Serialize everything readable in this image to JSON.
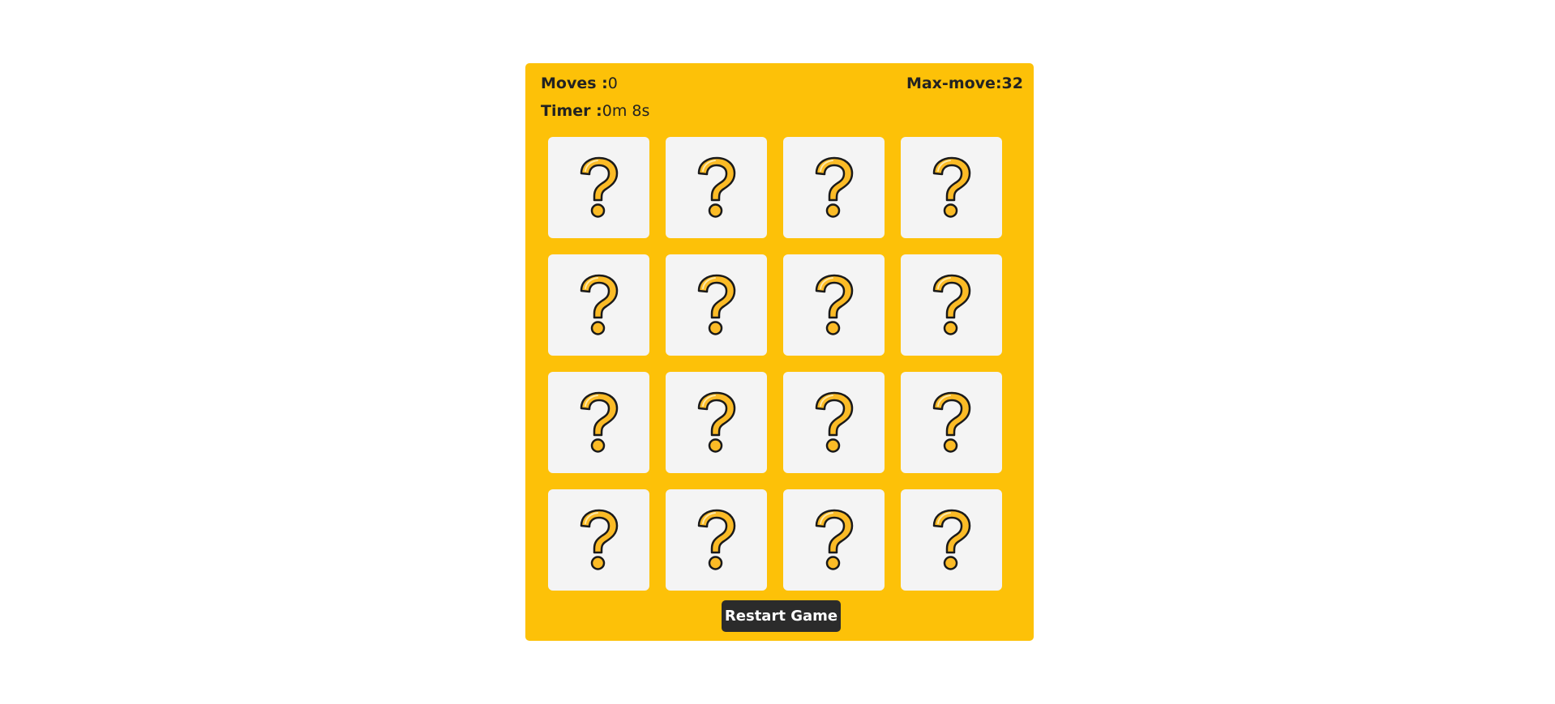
{
  "stats": {
    "moves_label": "Moves :",
    "moves_value": "0",
    "timer_label": "Timer :",
    "timer_value": "0m 8s",
    "max_moves_label": "Max-move:",
    "max_moves_value": "32"
  },
  "board": {
    "rows": 4,
    "columns": 4,
    "face_down_icon": "question-mark-icon",
    "cards_face_down": 16
  },
  "controls": {
    "restart_label": "Restart Game"
  },
  "colors": {
    "panel": "#fdc108",
    "card_back": "#f4f4f4",
    "question_mark_fill": "#fbbb26",
    "question_mark_outline": "#1a1a1a",
    "button": "#2b2b2b",
    "button_text": "#ffffff"
  }
}
